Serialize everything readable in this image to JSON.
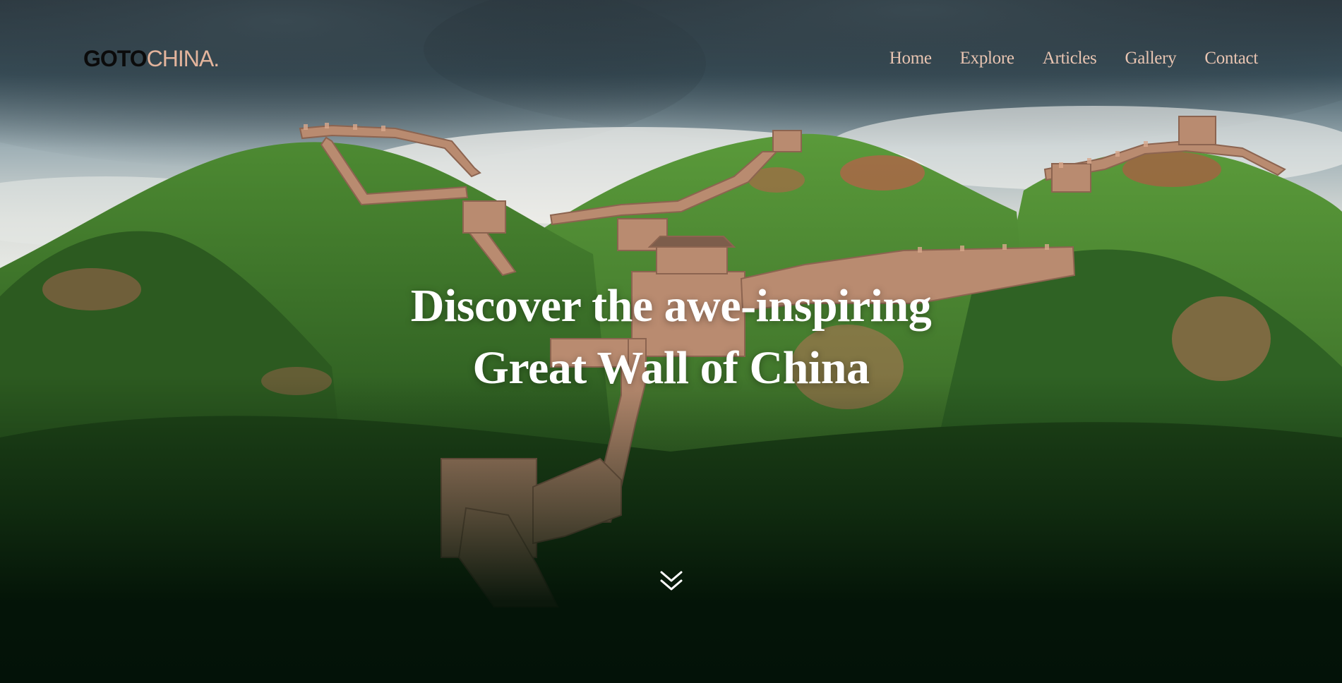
{
  "header": {
    "logo": {
      "part1": "GOTO",
      "part2": "CHINA."
    },
    "nav": [
      {
        "label": "Home"
      },
      {
        "label": "Explore"
      },
      {
        "label": "Articles"
      },
      {
        "label": "Gallery"
      },
      {
        "label": "Contact"
      }
    ]
  },
  "hero": {
    "headline_line1": "Discover the awe-inspiring",
    "headline_line2": "Great Wall of China",
    "scroll_icon": "double-chevron-down-icon"
  },
  "colors": {
    "logo_dark": "#0b0b0b",
    "accent_peach": "#e3b49c",
    "nav_text": "#e9c5b2",
    "headline": "#ffffff",
    "bottom_dark_green": "#031208"
  }
}
